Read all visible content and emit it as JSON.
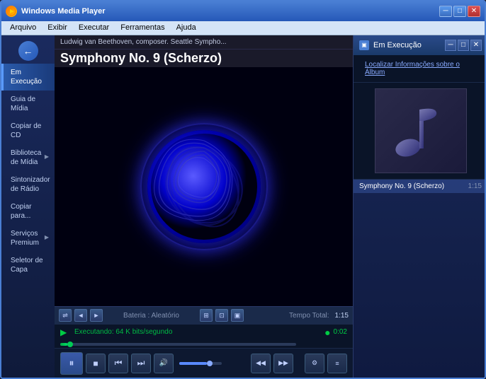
{
  "app": {
    "title": "Windows Media Player",
    "icon": "▶"
  },
  "title_bar": {
    "minimize_label": "─",
    "restore_label": "□",
    "close_label": "✕"
  },
  "menu": {
    "items": [
      "Arquivo",
      "Exibir",
      "Executar",
      "Ferramentas",
      "Ajuda"
    ]
  },
  "sidebar": {
    "back_icon": "←",
    "items": [
      {
        "label": "Em Execução",
        "active": true,
        "arrow": false
      },
      {
        "label": "Guia de Mídia",
        "active": false,
        "arrow": false
      },
      {
        "label": "Copiar de CD",
        "active": false,
        "arrow": false
      },
      {
        "label": "Biblioteca de Mídia",
        "active": false,
        "arrow": true
      },
      {
        "label": "Sintonizador de Rádio",
        "active": false,
        "arrow": false
      },
      {
        "label": "Copiar para...",
        "active": false,
        "arrow": false
      },
      {
        "label": "Serviços Premium",
        "active": false,
        "arrow": true
      },
      {
        "label": "Seletor de Capa",
        "active": false,
        "arrow": false
      }
    ]
  },
  "now_playing": {
    "artist_info": "Ludwig van Beethoven, composer. Seattle Sympho...",
    "title": "Symphony No. 9 (Scherzo)"
  },
  "controls_bar": {
    "shuffle_icon": "⇌",
    "prev_icon": "◄",
    "play_icon": "►",
    "status_text": "Bateria : Aleatório",
    "full_icon": "⊞",
    "extra_icon": "⊡",
    "vid_icon": "▣",
    "total_time_label": "Tempo Total:",
    "total_time": "1:15"
  },
  "status_bar": {
    "play_icon": "▶",
    "text": "Executando: 64 K bits/segundo",
    "time": "0:02",
    "dot": "●"
  },
  "playback": {
    "pause_icon": "⏸",
    "stop_icon": "■",
    "prev_icon": "⏮",
    "next_icon": "⏭",
    "rewind_icon": "◀◀",
    "forward_icon": "▶▶",
    "volume_icon": "🔊",
    "extra_icon": "≡"
  },
  "right_panel": {
    "header_title": "Em Execução",
    "find_info": "Localizar Informações sobre o Álbum",
    "close_icon": "✕",
    "minimize_icon": "─",
    "restore_icon": "□",
    "playlist": [
      {
        "title": "Symphony No. 9 (Scherzo)",
        "duration": "1:15",
        "active": true
      }
    ]
  }
}
